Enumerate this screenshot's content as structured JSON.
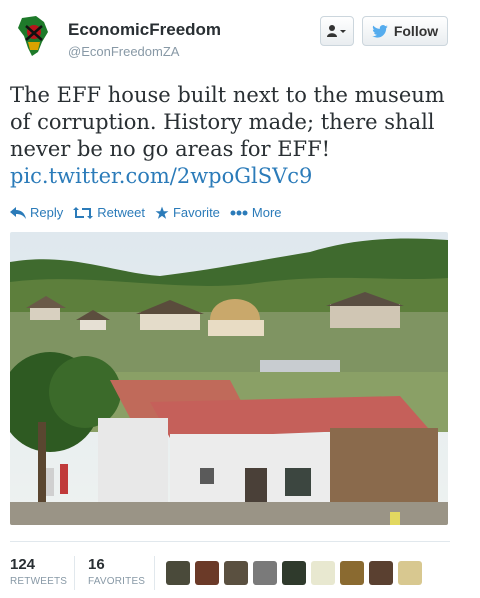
{
  "user": {
    "name": "EconomicFreedom",
    "handle": "@EconFreedomZA"
  },
  "buttons": {
    "follow_label": "Follow"
  },
  "tweet": {
    "text": "The EFF house built next to the museum of corruption. History made; there shall never be no go areas for EFF!",
    "link": "pic.twitter.com/2wpoGlSVc9"
  },
  "actions": {
    "reply": "Reply",
    "retweet": "Retweet",
    "favorite": "Favorite",
    "more": "More"
  },
  "stats": {
    "retweets_count": "124",
    "retweets_label": "RETWEETS",
    "favorites_count": "16",
    "favorites_label": "FAVORITES"
  },
  "favoriters": [
    {
      "name": "favoriter-avatar-1",
      "color": "#4a4a3a"
    },
    {
      "name": "favoriter-avatar-2",
      "color": "#6b3a28"
    },
    {
      "name": "favoriter-avatar-3",
      "color": "#5a5040"
    },
    {
      "name": "favoriter-avatar-4",
      "color": "#7a7a7a"
    },
    {
      "name": "favoriter-avatar-5",
      "color": "#2f3a2c"
    },
    {
      "name": "favoriter-avatar-6",
      "color": "#e8e8d0"
    },
    {
      "name": "favoriter-avatar-7",
      "color": "#8a6a30"
    },
    {
      "name": "favoriter-avatar-8",
      "color": "#5a4030"
    },
    {
      "name": "favoriter-avatar-9",
      "color": "#d8c890"
    }
  ],
  "colors": {
    "link": "#2b7bb9",
    "text": "#292f33",
    "muted": "#8899a6",
    "twitter_blue": "#55acee"
  }
}
